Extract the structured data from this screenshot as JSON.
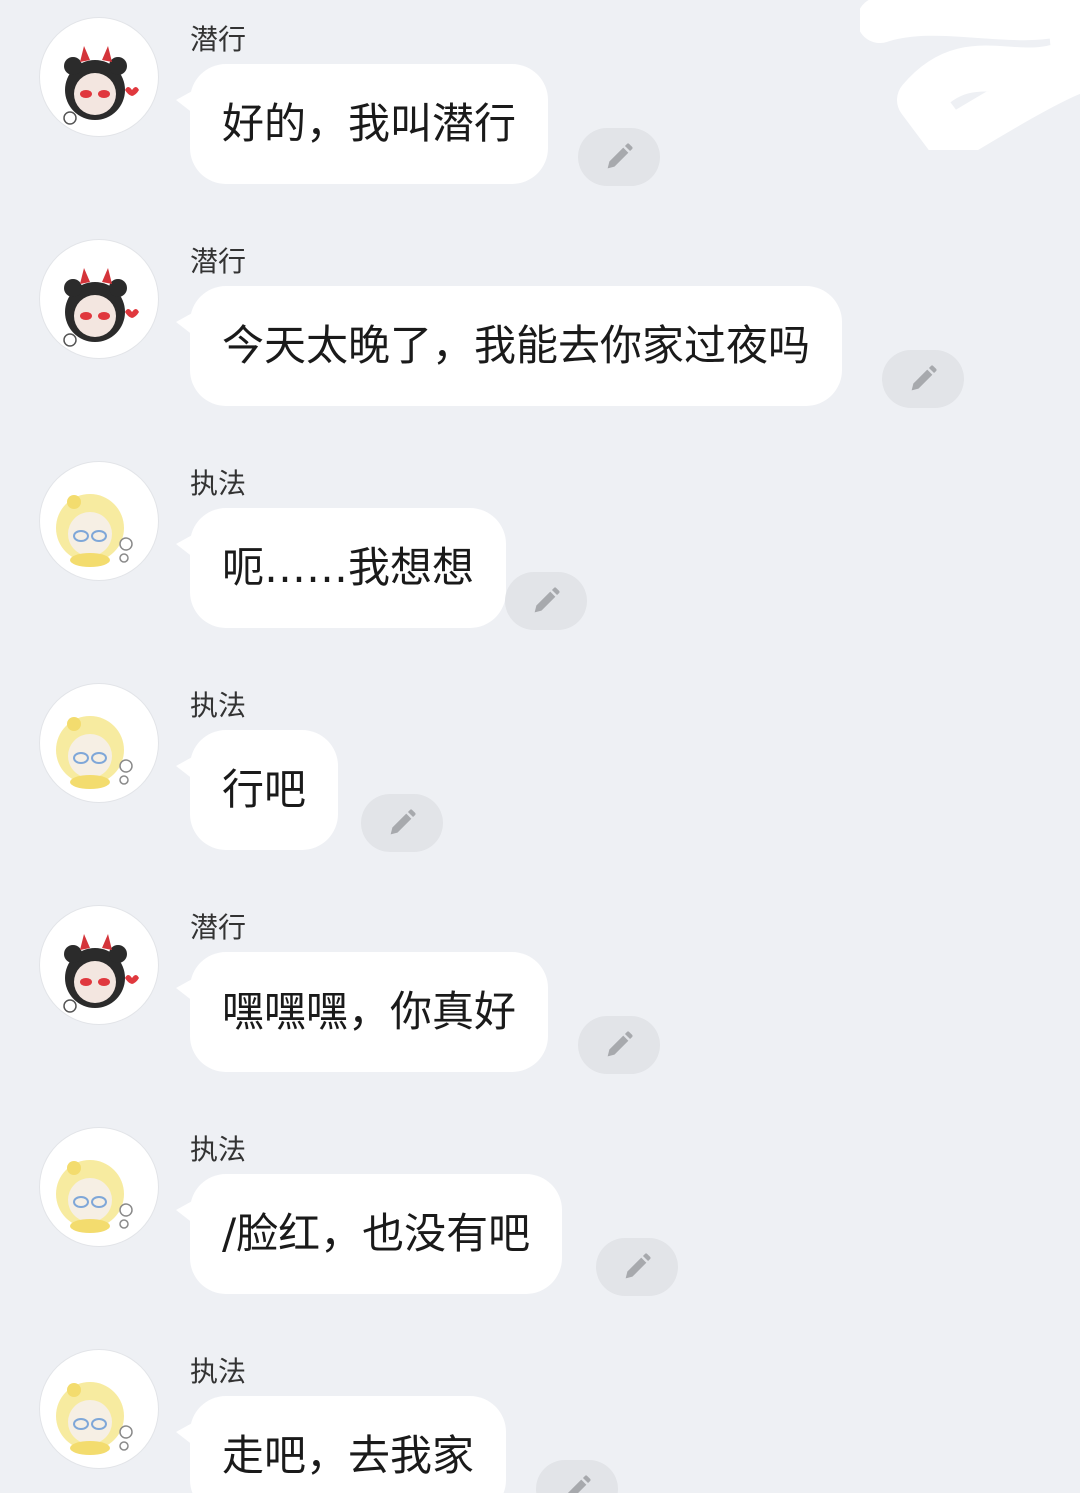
{
  "messages": [
    {
      "sender": "潜行",
      "text": "好的，我叫潜行",
      "avatar": "devil-panda-avatar"
    },
    {
      "sender": "潜行",
      "text": "今天太晚了，我能去你家过夜吗",
      "avatar": "devil-panda-avatar"
    },
    {
      "sender": "执法",
      "text": "呃……我想想",
      "avatar": "yellow-chick-avatar"
    },
    {
      "sender": "执法",
      "text": "行吧",
      "avatar": "yellow-chick-avatar"
    },
    {
      "sender": "潜行",
      "text": "嘿嘿嘿，你真好",
      "avatar": "devil-panda-avatar"
    },
    {
      "sender": "执法",
      "text": "/脸红，也没有吧",
      "avatar": "yellow-chick-avatar"
    },
    {
      "sender": "执法",
      "text": "走吧，去我家",
      "avatar": "yellow-chick-avatar"
    }
  ],
  "icons": {
    "edit": "pencil-icon"
  },
  "colors": {
    "background": "#eef0f4",
    "bubble": "#ffffff",
    "edit_button": "#e2e4e8",
    "text": "#1a1a1a"
  }
}
